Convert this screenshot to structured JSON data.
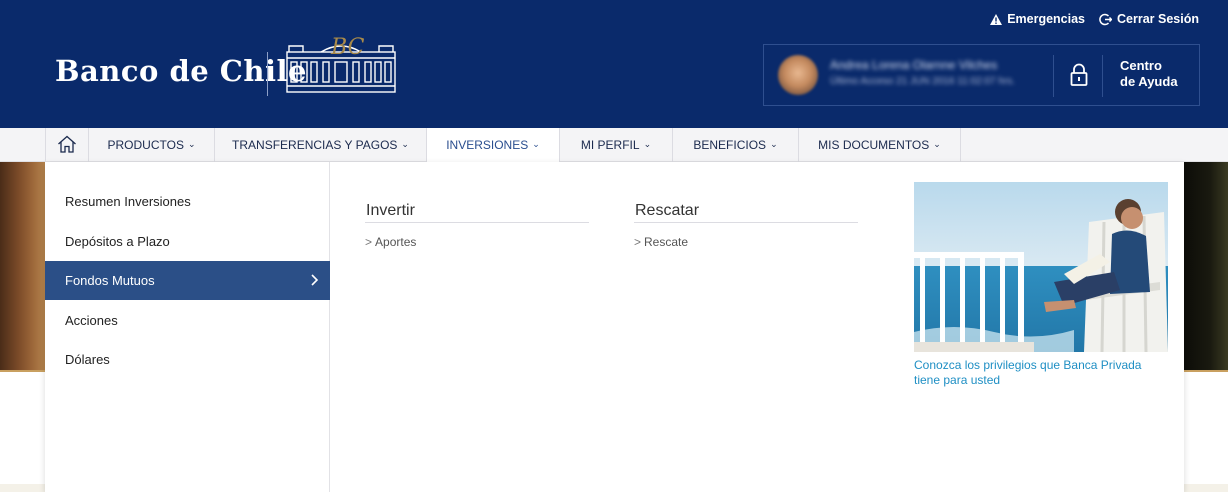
{
  "header": {
    "brand": "Banco de Chile",
    "emblem_monogram": "BC",
    "top_links": [
      {
        "label": "Emergencias",
        "icon": "warning-icon"
      },
      {
        "label": "Cerrar Sesión",
        "icon": "logout-icon"
      }
    ],
    "user": {
      "name": "Andrea Lorena Olarnne Vilches",
      "last_access": "Último Acceso 21 JUN 2016 11:02:07 hrs."
    },
    "help_label_line1": "Centro",
    "help_label_line2": "de Ayuda",
    "colors": {
      "header_bg": "#0a2a6b",
      "accent": "#2b4f87",
      "link": "#1f8fc4"
    }
  },
  "nav": {
    "home_icon": "home-icon",
    "items": [
      {
        "label": "PRODUCTOS"
      },
      {
        "label": "TRANSFERENCIAS Y PAGOS"
      },
      {
        "label": "INVERSIONES",
        "active": true
      },
      {
        "label": "MI PERFIL"
      },
      {
        "label": "BENEFICIOS"
      },
      {
        "label": "MIS DOCUMENTOS"
      }
    ]
  },
  "dropdown": {
    "sub_items": [
      {
        "label": "Resumen Inversiones"
      },
      {
        "label": "Depósitos a Plazo"
      },
      {
        "label": "Fondos Mutuos",
        "active": true
      },
      {
        "label": "Acciones"
      },
      {
        "label": "Dólares"
      }
    ],
    "columns": [
      {
        "title": "Invertir",
        "links": [
          "Aportes"
        ]
      },
      {
        "title": "Rescatar",
        "links": [
          "Rescate"
        ]
      }
    ],
    "promo": {
      "text_line1": "Conozca los privilegios que Banca Privada",
      "text_line2": "tiene para usted"
    }
  }
}
